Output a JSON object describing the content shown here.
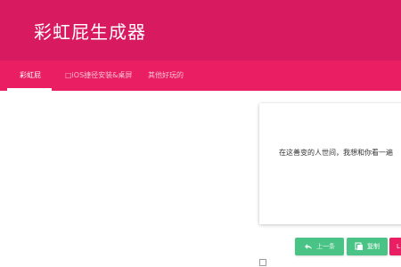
{
  "header": {
    "title": "彩虹屁生成器",
    "color": "#d81b60"
  },
  "tabs": {
    "color": "#e91e63",
    "items": [
      {
        "label": "彩虹屁",
        "active": true
      },
      {
        "label": "□iOS捷径安装&桌屏",
        "active": false
      },
      {
        "label": "其他好玩的",
        "active": false
      }
    ]
  },
  "card": {
    "text": "在这善变的人世间，我想和你看一遍"
  },
  "buttons": {
    "prev_label": "上一条",
    "prev_icon": "reply-arrow-icon",
    "copy_label": "复制",
    "copy_icon": "copy-icon",
    "pink_label": "L",
    "accent_green": "#49c486"
  }
}
